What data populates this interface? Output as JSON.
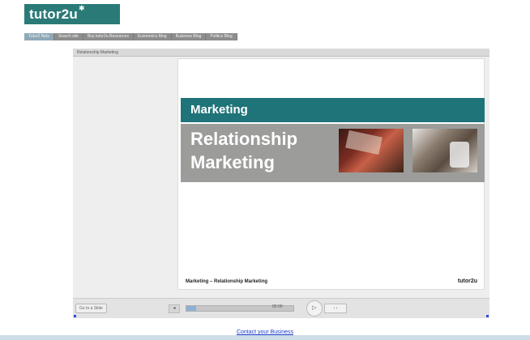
{
  "logo": {
    "text": "tutor2u",
    "star": "✱"
  },
  "nav": {
    "items": [
      {
        "label": "Tutor2 Nets",
        "active": true
      },
      {
        "label": "Search site",
        "active": false
      },
      {
        "label": "Buy tutor2u Resources",
        "active": false
      },
      {
        "label": "Economics Blog",
        "active": false
      },
      {
        "label": "Business Blog",
        "active": false
      },
      {
        "label": "Politics Blog",
        "active": false
      }
    ]
  },
  "frame": {
    "title": "Relationship Marketing"
  },
  "slide": {
    "band_title": "Marketing",
    "main_title": "Relationship Marketing",
    "footer_text": "Marketing – Relationship Marketing",
    "brand": "tutor2u"
  },
  "controls": {
    "left_button": "Go to a Slide",
    "prev": "◂",
    "time": "00:00",
    "play": "▷",
    "step": "‹ ›",
    "progress": 0.09
  },
  "footer": {
    "link": "Contact your Business"
  },
  "colors": {
    "teal": "#1f7479",
    "logo_bg": "#2a7a78",
    "grey_band": "#9c9c9a",
    "link": "#1a3bcc"
  },
  "icons": {
    "play": "play-icon",
    "prev": "previous-icon"
  }
}
